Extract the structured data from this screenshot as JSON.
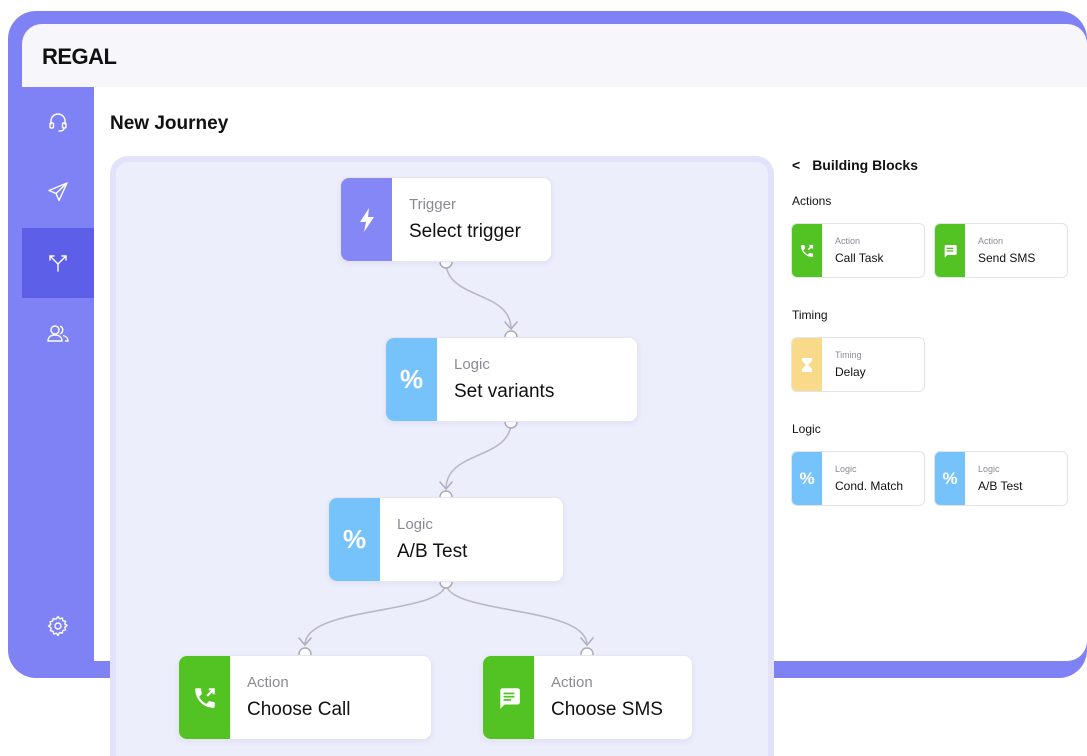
{
  "app": {
    "brand": "REGAL"
  },
  "page": {
    "title": "New Journey"
  },
  "sidebar": {
    "items": [
      {
        "icon": "headset-icon",
        "active": false
      },
      {
        "icon": "send-icon",
        "active": false
      },
      {
        "icon": "journey-split-icon",
        "active": true
      },
      {
        "icon": "users-icon",
        "active": false
      }
    ],
    "bottom_icon": "gear-icon"
  },
  "canvas": {
    "nodes": {
      "trigger": {
        "category": "Trigger",
        "label": "Select trigger",
        "icon": "lightning-icon"
      },
      "variants": {
        "category": "Logic",
        "label": "Set variants",
        "icon": "percent-icon"
      },
      "abtest": {
        "category": "Logic",
        "label": "A/B Test",
        "icon": "percent-icon"
      },
      "call": {
        "category": "Action",
        "label": "Choose Call",
        "icon": "phone-call-icon"
      },
      "sms": {
        "category": "Action",
        "label": "Choose SMS",
        "icon": "message-icon"
      }
    },
    "percent_glyph": "%"
  },
  "panel": {
    "back": "<",
    "title": "Building Blocks",
    "sections": {
      "actions": "Actions",
      "timing": "Timing",
      "logic": "Logic"
    },
    "blocks": {
      "call_task": {
        "category": "Action",
        "label": "Call Task"
      },
      "send_sms": {
        "category": "Action",
        "label": "Send SMS"
      },
      "delay": {
        "category": "Timing",
        "label": "Delay"
      },
      "cond_match": {
        "category": "Logic",
        "label": "Cond. Match"
      },
      "ab_test": {
        "category": "Logic",
        "label": "A/B Test"
      }
    }
  },
  "colors": {
    "frame": "#7f82f4",
    "sidebar_active": "#5d5fe8",
    "trigger": "#8487f5",
    "logic": "#76c3fb",
    "action": "#52c322",
    "timing": "#f9d98a",
    "canvas_bg": "#edeefc"
  }
}
